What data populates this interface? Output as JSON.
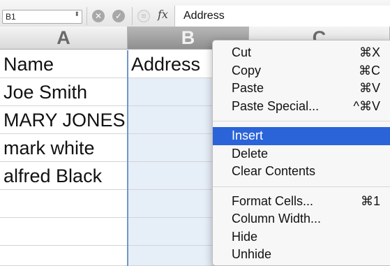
{
  "formula_bar": {
    "name_box": "B1",
    "name_box_stepper": "⬍",
    "cancel_glyph": "✕",
    "enter_glyph": "✓",
    "function_glyph": "=",
    "fx_label": "fx",
    "formula": "Address"
  },
  "columns": [
    "A",
    "B",
    "C"
  ],
  "cells": {
    "a1": "Name",
    "b1": "Address",
    "a2": "Joe Smith",
    "a3": "MARY JONES",
    "a4": "mark white",
    "a5": "alfred Black"
  },
  "context_menu": {
    "groups": [
      [
        {
          "label": "Cut",
          "shortcut": "⌘X"
        },
        {
          "label": "Copy",
          "shortcut": "⌘C"
        },
        {
          "label": "Paste",
          "shortcut": "⌘V"
        },
        {
          "label": "Paste Special...",
          "shortcut": "^⌘V"
        }
      ],
      [
        {
          "label": "Insert",
          "shortcut": ""
        },
        {
          "label": "Delete",
          "shortcut": ""
        },
        {
          "label": "Clear Contents",
          "shortcut": ""
        }
      ],
      [
        {
          "label": "Format Cells...",
          "shortcut": "⌘1"
        },
        {
          "label": "Column Width...",
          "shortcut": ""
        },
        {
          "label": "Hide",
          "shortcut": ""
        },
        {
          "label": "Unhide",
          "shortcut": ""
        }
      ]
    ],
    "highlighted": "Insert"
  },
  "colors": {
    "highlight": "#2b64d9",
    "selection": "#e6eef8",
    "selection_border": "#6f97c6"
  }
}
